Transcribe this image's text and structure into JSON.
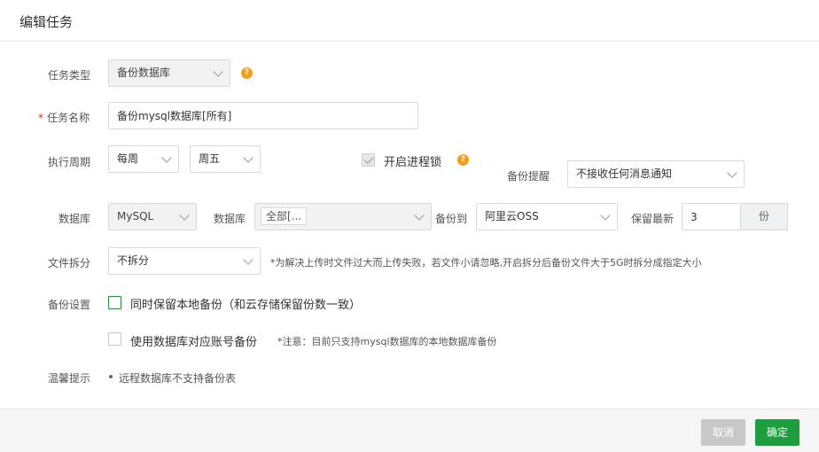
{
  "dialog": {
    "title": "编辑任务",
    "cancel_label": "取消",
    "confirm_label": "确定"
  },
  "form": {
    "task_type": {
      "label": "任务类型",
      "value": "备份数据库"
    },
    "task_name": {
      "label": "任务名称",
      "value": "备份mysql数据库[所有]"
    },
    "period": {
      "label": "执行周期",
      "freq": "每周",
      "day": "周五"
    },
    "lock": {
      "label": "开启进程锁",
      "checked": true
    },
    "reminder": {
      "label": "备份提醒",
      "value": "不接收任何消息通知"
    },
    "database": {
      "label": "数据库",
      "type": "MySQL",
      "db_label": "数据库",
      "db_value": "全部[...",
      "target_label": "备份到",
      "target": "阿里云OSS",
      "keep_label": "保留最新",
      "keep_value": "3",
      "keep_unit": "份"
    },
    "split": {
      "label": "文件拆分",
      "value": "不拆分",
      "note": "*为解决上传时文件过大而上传失败，若文件小请忽略,开启拆分后备份文件大于5G时拆分成指定大小"
    },
    "backup_settings": {
      "label": "备份设置",
      "local_copy": "同时保留本地备份（和云存储保留份数一致）",
      "db_account": "使用数据库对应账号备份",
      "db_account_note": "*注意：目前只支持mysql数据库的本地数据库备份"
    },
    "tips": {
      "label": "温馨提示",
      "items": [
        "远程数据库不支持备份表"
      ]
    }
  },
  "icons": {
    "help": "question-circle-icon",
    "dropdown": "chevron-down-icon"
  },
  "colors": {
    "primary": "#1e9e3e",
    "help": "#f0a020",
    "required": "#e0282e"
  }
}
